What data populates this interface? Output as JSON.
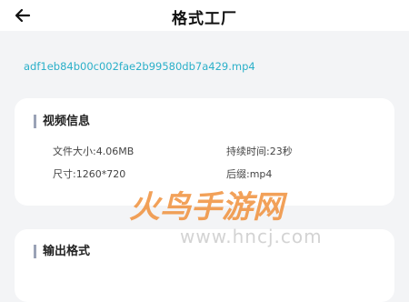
{
  "header": {
    "title": "格式工厂",
    "back_icon": "arrow-left-icon"
  },
  "file": {
    "name": "adf1eb84b00c002fae2b99580db7a429.mp4"
  },
  "video_info": {
    "title": "视频信息",
    "file_size": "文件大小:4.06MB",
    "duration": "持续时间:23秒",
    "dimensions": "尺寸:1260*720",
    "extension": "后缀:mp4"
  },
  "output_format": {
    "title": "输出格式"
  },
  "watermark": {
    "text_cn": "火鸟手游网",
    "url": "www.hncj.com"
  },
  "colors": {
    "accent": "#2bb0c9",
    "watermark": "#f08a30"
  }
}
